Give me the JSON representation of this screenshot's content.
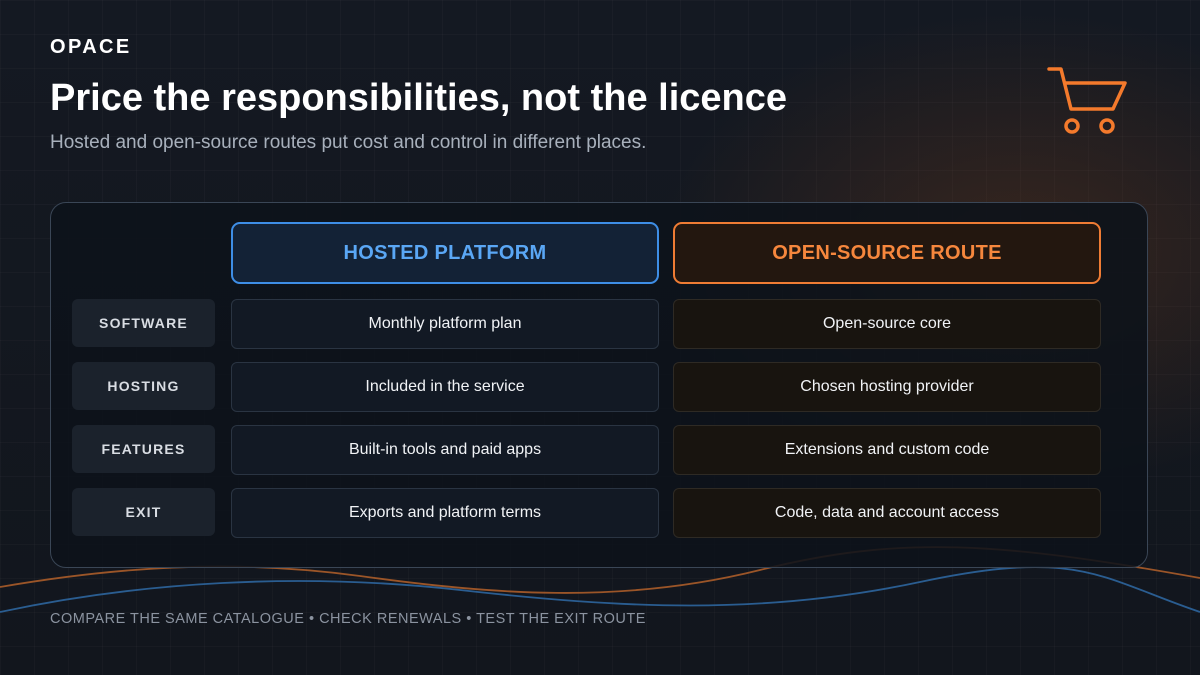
{
  "brand": "OPACE",
  "title": "Price the responsibilities, not the licence",
  "subtitle": "Hosted and open-source routes put cost and control in different places.",
  "icon": "shopping-cart-icon",
  "colors": {
    "background": "#12161d",
    "hosted_accent": "#3e8ee6",
    "open_source_accent": "#ef7c34"
  },
  "columns": {
    "hosted": "HOSTED PLATFORM",
    "open_source": "OPEN-SOURCE ROUTE"
  },
  "rows": [
    {
      "label": "SOFTWARE",
      "hosted": "Monthly platform plan",
      "open_source": "Open-source core"
    },
    {
      "label": "HOSTING",
      "hosted": "Included in the service",
      "open_source": "Chosen hosting provider"
    },
    {
      "label": "FEATURES",
      "hosted": "Built-in tools and paid apps",
      "open_source": "Extensions and custom code"
    },
    {
      "label": "EXIT",
      "hosted": "Exports and platform terms",
      "open_source": "Code, data and account access"
    }
  ],
  "footer": "COMPARE THE SAME CATALOGUE • CHECK RENEWALS • TEST THE EXIT ROUTE"
}
